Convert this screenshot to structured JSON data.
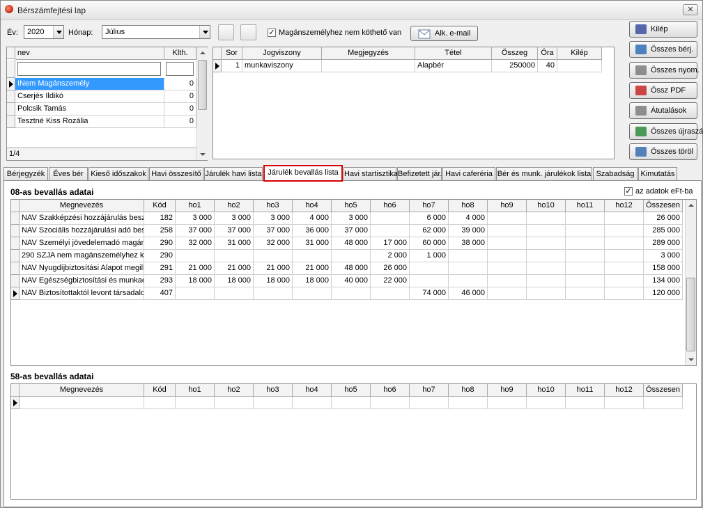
{
  "window": {
    "title": "Bérszámfejtési lap",
    "close_glyph": "✕"
  },
  "filters": {
    "year_label": "Év:",
    "year": "2020",
    "month_label": "Hónap:",
    "month": "Július",
    "private_checkbox_label": "Magánszemélyhez nem köthető van",
    "private_checked": true,
    "email_button": "Alk. e-mail"
  },
  "employees": {
    "columns": [
      "nev",
      "Klth."
    ],
    "rows": [
      {
        "name": "INem Magánszemély",
        "klth": "0"
      },
      {
        "name": "Cserjés Ildikó",
        "klth": "0"
      },
      {
        "name": "Polcsik Tamás",
        "klth": "0"
      },
      {
        "name": "Tesztné Kiss Rozália",
        "klth": "0"
      }
    ],
    "position": "1/4"
  },
  "employment": {
    "columns": [
      "Sor",
      "Jogviszony",
      "Megjegyzés",
      "Tétel",
      "Összeg",
      "Óra",
      "Kilép"
    ],
    "rows": [
      [
        "1",
        "munkaviszony",
        "",
        "Alapbér",
        "250000",
        "40",
        ""
      ]
    ]
  },
  "side_buttons": [
    "Kilép",
    "Összes bérj.",
    "Összes nyom.",
    "Össz PDF",
    "Átutalások",
    "Összes újraszá.",
    "Összes töröl"
  ],
  "tabs": [
    "Bérjegyzék",
    "Éves bér",
    "Kieső időszakok",
    "Havi összesítő",
    "Járulék havi lista",
    "Járulék bevallás lista",
    "Havi startisztika",
    "Befizetett jár.",
    "Havi caferéria",
    "Bér és munk. járulékok lista",
    "Szabadság",
    "Kimutatás"
  ],
  "active_tab": "Járulék bevallás lista",
  "section08": {
    "title": "08-as bevallás adatai",
    "eft_label": "az adatok eFt-ba",
    "eft_checked": true,
    "columns": [
      "Megnevezés",
      "Kód",
      "ho1",
      "ho2",
      "ho3",
      "ho4",
      "ho5",
      "ho6",
      "ho7",
      "ho8",
      "ho9",
      "ho10",
      "ho11",
      "ho12",
      "Összesen"
    ],
    "rows": [
      [
        "NAV Szakképzési hozzájárulás besze",
        "182",
        "3 000",
        "3 000",
        "3 000",
        "4 000",
        "3 000",
        "",
        "6 000",
        "4 000",
        "",
        "",
        "",
        "",
        "26 000"
      ],
      [
        "NAV Szociális hozzájárulási adó besz",
        "258",
        "37 000",
        "37 000",
        "37 000",
        "36 000",
        "37 000",
        "",
        "62 000",
        "39 000",
        "",
        "",
        "",
        "",
        "285 000"
      ],
      [
        "NAV Személyi jövedelemadó magáns",
        "290",
        "32 000",
        "31 000",
        "32 000",
        "31 000",
        "48 000",
        "17 000",
        "60 000",
        "38 000",
        "",
        "",
        "",
        "",
        "289 000"
      ],
      [
        "290 SZJA nem magánszemélyhez kö",
        "290",
        "",
        "",
        "",
        "",
        "",
        "2 000",
        "1 000",
        "",
        "",
        "",
        "",
        "",
        "3 000"
      ],
      [
        "NAV Nyugdíjbiztosítási Alapot megille",
        "291",
        "21 000",
        "21 000",
        "21 000",
        "21 000",
        "48 000",
        "26 000",
        "",
        "",
        "",
        "",
        "",
        "",
        "158 000"
      ],
      [
        "NAV Egészségbiztosítási és munkaer",
        "293",
        "18 000",
        "18 000",
        "18 000",
        "18 000",
        "40 000",
        "22 000",
        "",
        "",
        "",
        "",
        "",
        "",
        "134 000"
      ],
      [
        "NAV Biztosítottaktól levont társadalo",
        "407",
        "",
        "",
        "",
        "",
        "",
        "",
        "74 000",
        "46 000",
        "",
        "",
        "",
        "",
        "120 000"
      ]
    ]
  },
  "section58": {
    "title": "58-as bevallás adatai",
    "columns": [
      "Megnevezés",
      "Kód",
      "ho1",
      "ho2",
      "ho3",
      "ho4",
      "ho5",
      "ho6",
      "ho7",
      "ho8",
      "ho9",
      "ho10",
      "ho11",
      "ho12",
      "Összesen"
    ]
  }
}
